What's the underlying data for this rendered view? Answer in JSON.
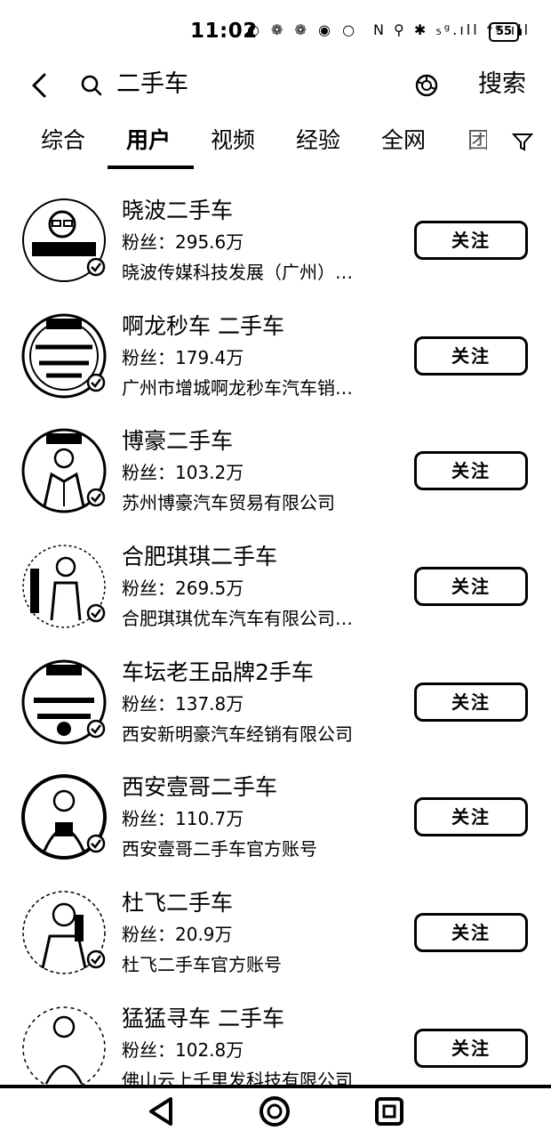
{
  "status_bar": {
    "time": "11:02",
    "left_icons": "◐ ❁ ❁ ◉ ○",
    "right_icons": "N ⚲ ✱ ₅ᵍ.ıll ⁴ᵍ.ıll",
    "battery": "55"
  },
  "search": {
    "query": "二手车",
    "search_label": "搜索"
  },
  "tabs": [
    {
      "label": "综合"
    },
    {
      "label": "用户"
    },
    {
      "label": "视频"
    },
    {
      "label": "经验"
    },
    {
      "label": "全网"
    },
    {
      "label": "团"
    }
  ],
  "follow_label": "关注",
  "users": [
    {
      "name": "晓波二手车",
      "fans": "粉丝：295.6万",
      "desc": "晓波传媒科技发展（广州）…"
    },
    {
      "name": "啊龙秒车 二手车",
      "fans": "粉丝：179.4万",
      "desc": "广州市增城啊龙秒车汽车销…"
    },
    {
      "name": "博豪二手车",
      "fans": "粉丝：103.2万",
      "desc": "苏州博豪汽车贸易有限公司"
    },
    {
      "name": "合肥琪琪二手车",
      "fans": "粉丝：269.5万",
      "desc": "合肥琪琪优车汽车有限公司…"
    },
    {
      "name": "车坛老王品牌2手车",
      "fans": "粉丝：137.8万",
      "desc": "西安新明豪汽车经销有限公司"
    },
    {
      "name": "西安壹哥二手车",
      "fans": "粉丝：110.7万",
      "desc": "西安壹哥二手车官方账号"
    },
    {
      "name": "杜飞二手车",
      "fans": "粉丝：20.9万",
      "desc": "杜飞二手车官方账号"
    },
    {
      "name": "猛猛寻车 二手车",
      "fans": "粉丝：102.8万",
      "desc": "佛山云上千里发科技有限公司"
    }
  ]
}
